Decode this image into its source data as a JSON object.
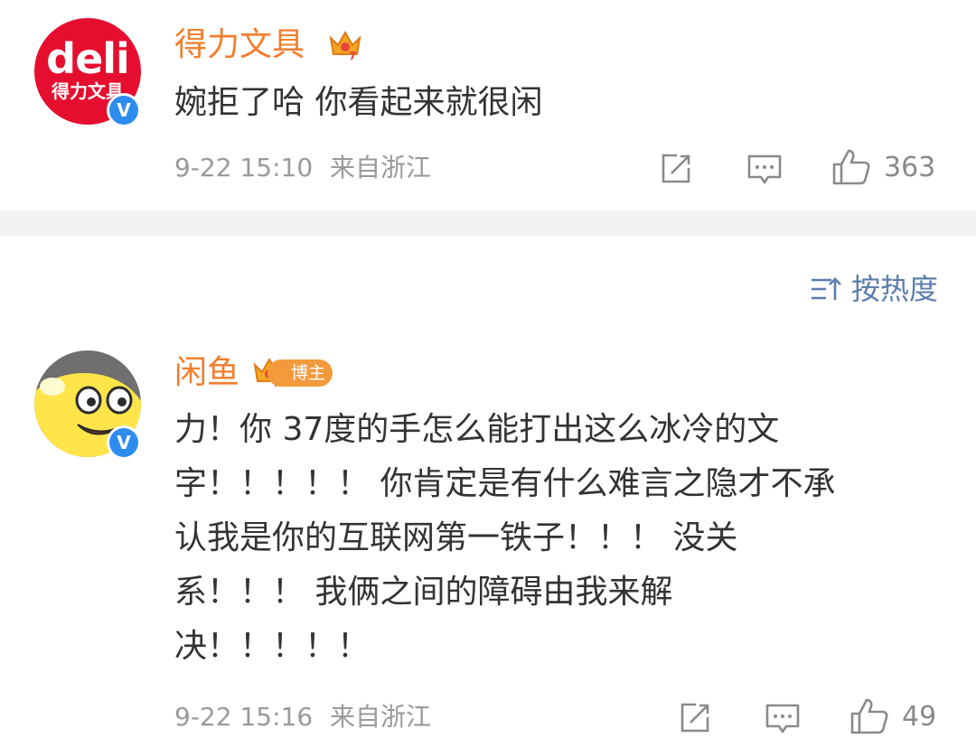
{
  "comments": [
    {
      "username": "得力文具",
      "avatar_text": "deli",
      "avatar_cn": "得力文具",
      "verified_mark": "V",
      "text_lines": [
        "婉拒了哈 你看起来就很闲"
      ],
      "date": "9-22 15:10",
      "location": "来自浙江",
      "likes": "363"
    },
    {
      "username": "闲鱼",
      "verified_mark": "V",
      "badge": "博主",
      "text_lines": [
        "力！你 37度的手怎么能打出这么冰冷的文",
        "字！！！！！ 你肯定是有什么难言之隐才不承",
        "认我是你的互联网第一铁子！！！ 没关",
        "系！！！ 我俩之间的障碍由我来解",
        "决！！！！！"
      ],
      "date": "9-22 15:16",
      "location": "来自浙江",
      "likes": "49"
    }
  ],
  "sort": {
    "label": "按热度",
    "icon": "sort-icon"
  },
  "colors": {
    "username": "#f27e2d",
    "sort": "#5b7dae",
    "verified": "#2d8cf0",
    "deli_red": "#e60e2f"
  }
}
